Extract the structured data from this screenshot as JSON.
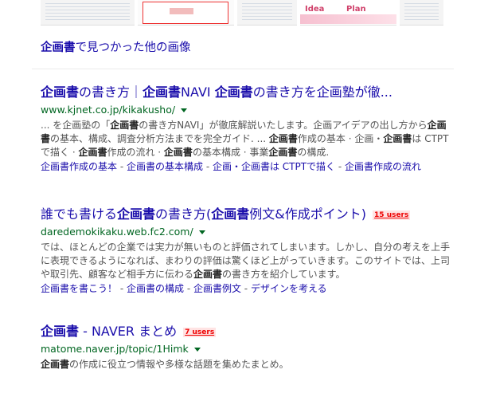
{
  "images_section": {
    "thumb4_idea": "Idea",
    "thumb4_plan": "Plan",
    "more_images_bold": "企画書",
    "more_images_rest": "で見つかった他の画像"
  },
  "results": [
    {
      "title_parts": [
        "企画書",
        "の書き方｜",
        "企画書",
        "NAVI ",
        "企画書",
        "の書き方を企画塾が徹..."
      ],
      "url": "www.kjnet.co.jp/kikakusho/",
      "snippet_parts": [
        "... を企画塾の「",
        "企画書",
        "の書き方NAVI」が徹底解説いたします。企画アイデアの出し方から",
        "企画書",
        "の基本、構成、調査分析方法までを完全ガイド. ... ",
        "企画書",
        "作成の基本 · 企画・",
        "企画書",
        "は CTPTで描く · ",
        "企画書",
        "作成の流れ · ",
        "企画書",
        "の基本構成 · 事業",
        "企画書",
        "の構成."
      ],
      "sitelinks": [
        "企画書作成の基本",
        "企画書の基本構成",
        "企画・企画書は CTPTで描く",
        "企画書作成の流れ"
      ]
    },
    {
      "title_parts": [
        "誰でも書ける",
        "企画書",
        "の書き方(",
        "企画書",
        "例文&作成ポイント)"
      ],
      "users": "15 users",
      "url": "daredemokikaku.web.fc2.com/",
      "snippet_parts": [
        "では、ほとんどの企業では実力が無いものと評価されてしまいます。しかし、自分の考えを上手に表現できるようになれば、まわりの評価は驚くほど上がっていきます。このサイトでは、上司や取引先、顧客など相手方に伝わる",
        "企画書",
        "の書き方を紹介しています。"
      ],
      "sitelinks": [
        "企画書を書こう！",
        "企画書の構成",
        "企画書例文",
        "デザインを考える"
      ]
    },
    {
      "title_parts": [
        "企画書",
        " - NAVER まとめ"
      ],
      "users": "7 users",
      "url": "matome.naver.jp/topic/1Himk",
      "snippet_parts": [
        "企画書",
        "の作成に役立つ情報や多様な話題を集めたまとめ。"
      ]
    }
  ]
}
